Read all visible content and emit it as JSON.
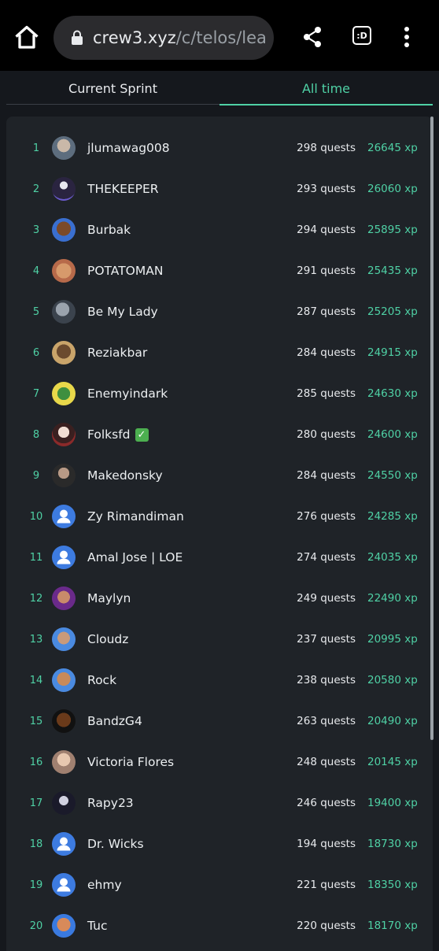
{
  "browser": {
    "url_host": "crew3.xyz",
    "url_path": "/c/telos/lea",
    "tabs_label": ":D"
  },
  "tabs": [
    {
      "label": "Current Sprint",
      "active": false
    },
    {
      "label": "All time",
      "active": true
    }
  ],
  "colors": {
    "accent": "#4fd1a5",
    "background": "#15181d",
    "panel": "#1f2328"
  },
  "leaderboard": [
    {
      "rank": "1",
      "name": "jlumawag008",
      "quests": "298 quests",
      "xp": "26645 xp",
      "avatar": "photo-avatar"
    },
    {
      "rank": "2",
      "name": "THEKEEPER",
      "quests": "293 quests",
      "xp": "26060 xp",
      "avatar": "hooded-figure-avatar"
    },
    {
      "rank": "3",
      "name": "Burbak",
      "quests": "294 quests",
      "xp": "25895 xp",
      "avatar": "cartoon-avatar"
    },
    {
      "rank": "4",
      "name": "POTATOMAN",
      "quests": "291 quests",
      "xp": "25435 xp",
      "avatar": "potato-avatar"
    },
    {
      "rank": "5",
      "name": "Be My Lady",
      "quests": "287 quests",
      "xp": "25205 xp",
      "avatar": "cat-avatar"
    },
    {
      "rank": "6",
      "name": "Reziakbar",
      "quests": "284 quests",
      "xp": "24915 xp",
      "avatar": "photo-avatar"
    },
    {
      "rank": "7",
      "name": "Enemyindark",
      "quests": "285 quests",
      "xp": "24630 xp",
      "avatar": "frog-avatar"
    },
    {
      "rank": "8",
      "name": "Folksfd",
      "quests": "280 quests",
      "xp": "24600 xp",
      "avatar": "anime-avatar",
      "verified": "✓"
    },
    {
      "rank": "9",
      "name": "Makedonsky",
      "quests": "284 quests",
      "xp": "24550 xp",
      "avatar": "photo-avatar"
    },
    {
      "rank": "10",
      "name": "Zy Rimandiman",
      "quests": "276 quests",
      "xp": "24285 xp",
      "avatar": "default-user-avatar"
    },
    {
      "rank": "11",
      "name": "Amal Jose | LOE",
      "quests": "274 quests",
      "xp": "24035 xp",
      "avatar": "default-user-avatar"
    },
    {
      "rank": "12",
      "name": "Maylyn",
      "quests": "249 quests",
      "xp": "22490 xp",
      "avatar": "cartoon-avatar"
    },
    {
      "rank": "13",
      "name": "Cloudz",
      "quests": "237 quests",
      "xp": "20995 xp",
      "avatar": "cartoon-avatar"
    },
    {
      "rank": "14",
      "name": "Rock",
      "quests": "238 quests",
      "xp": "20580 xp",
      "avatar": "cartoon-avatar"
    },
    {
      "rank": "15",
      "name": "BandzG4",
      "quests": "263 quests",
      "xp": "20490 xp",
      "avatar": "cartoon-avatar"
    },
    {
      "rank": "16",
      "name": "Victoria Flores",
      "quests": "248 quests",
      "xp": "20145 xp",
      "avatar": "photo-avatar"
    },
    {
      "rank": "17",
      "name": "Rapy23",
      "quests": "246 quests",
      "xp": "19400 xp",
      "avatar": "anime-avatar"
    },
    {
      "rank": "18",
      "name": "Dr. Wicks",
      "quests": "194 quests",
      "xp": "18730 xp",
      "avatar": "default-user-avatar"
    },
    {
      "rank": "19",
      "name": "ehmy",
      "quests": "221 quests",
      "xp": "18350 xp",
      "avatar": "default-user-avatar"
    },
    {
      "rank": "20",
      "name": "Tuc",
      "quests": "220 quests",
      "xp": "18170 xp",
      "avatar": "cartoon-avatar"
    }
  ]
}
